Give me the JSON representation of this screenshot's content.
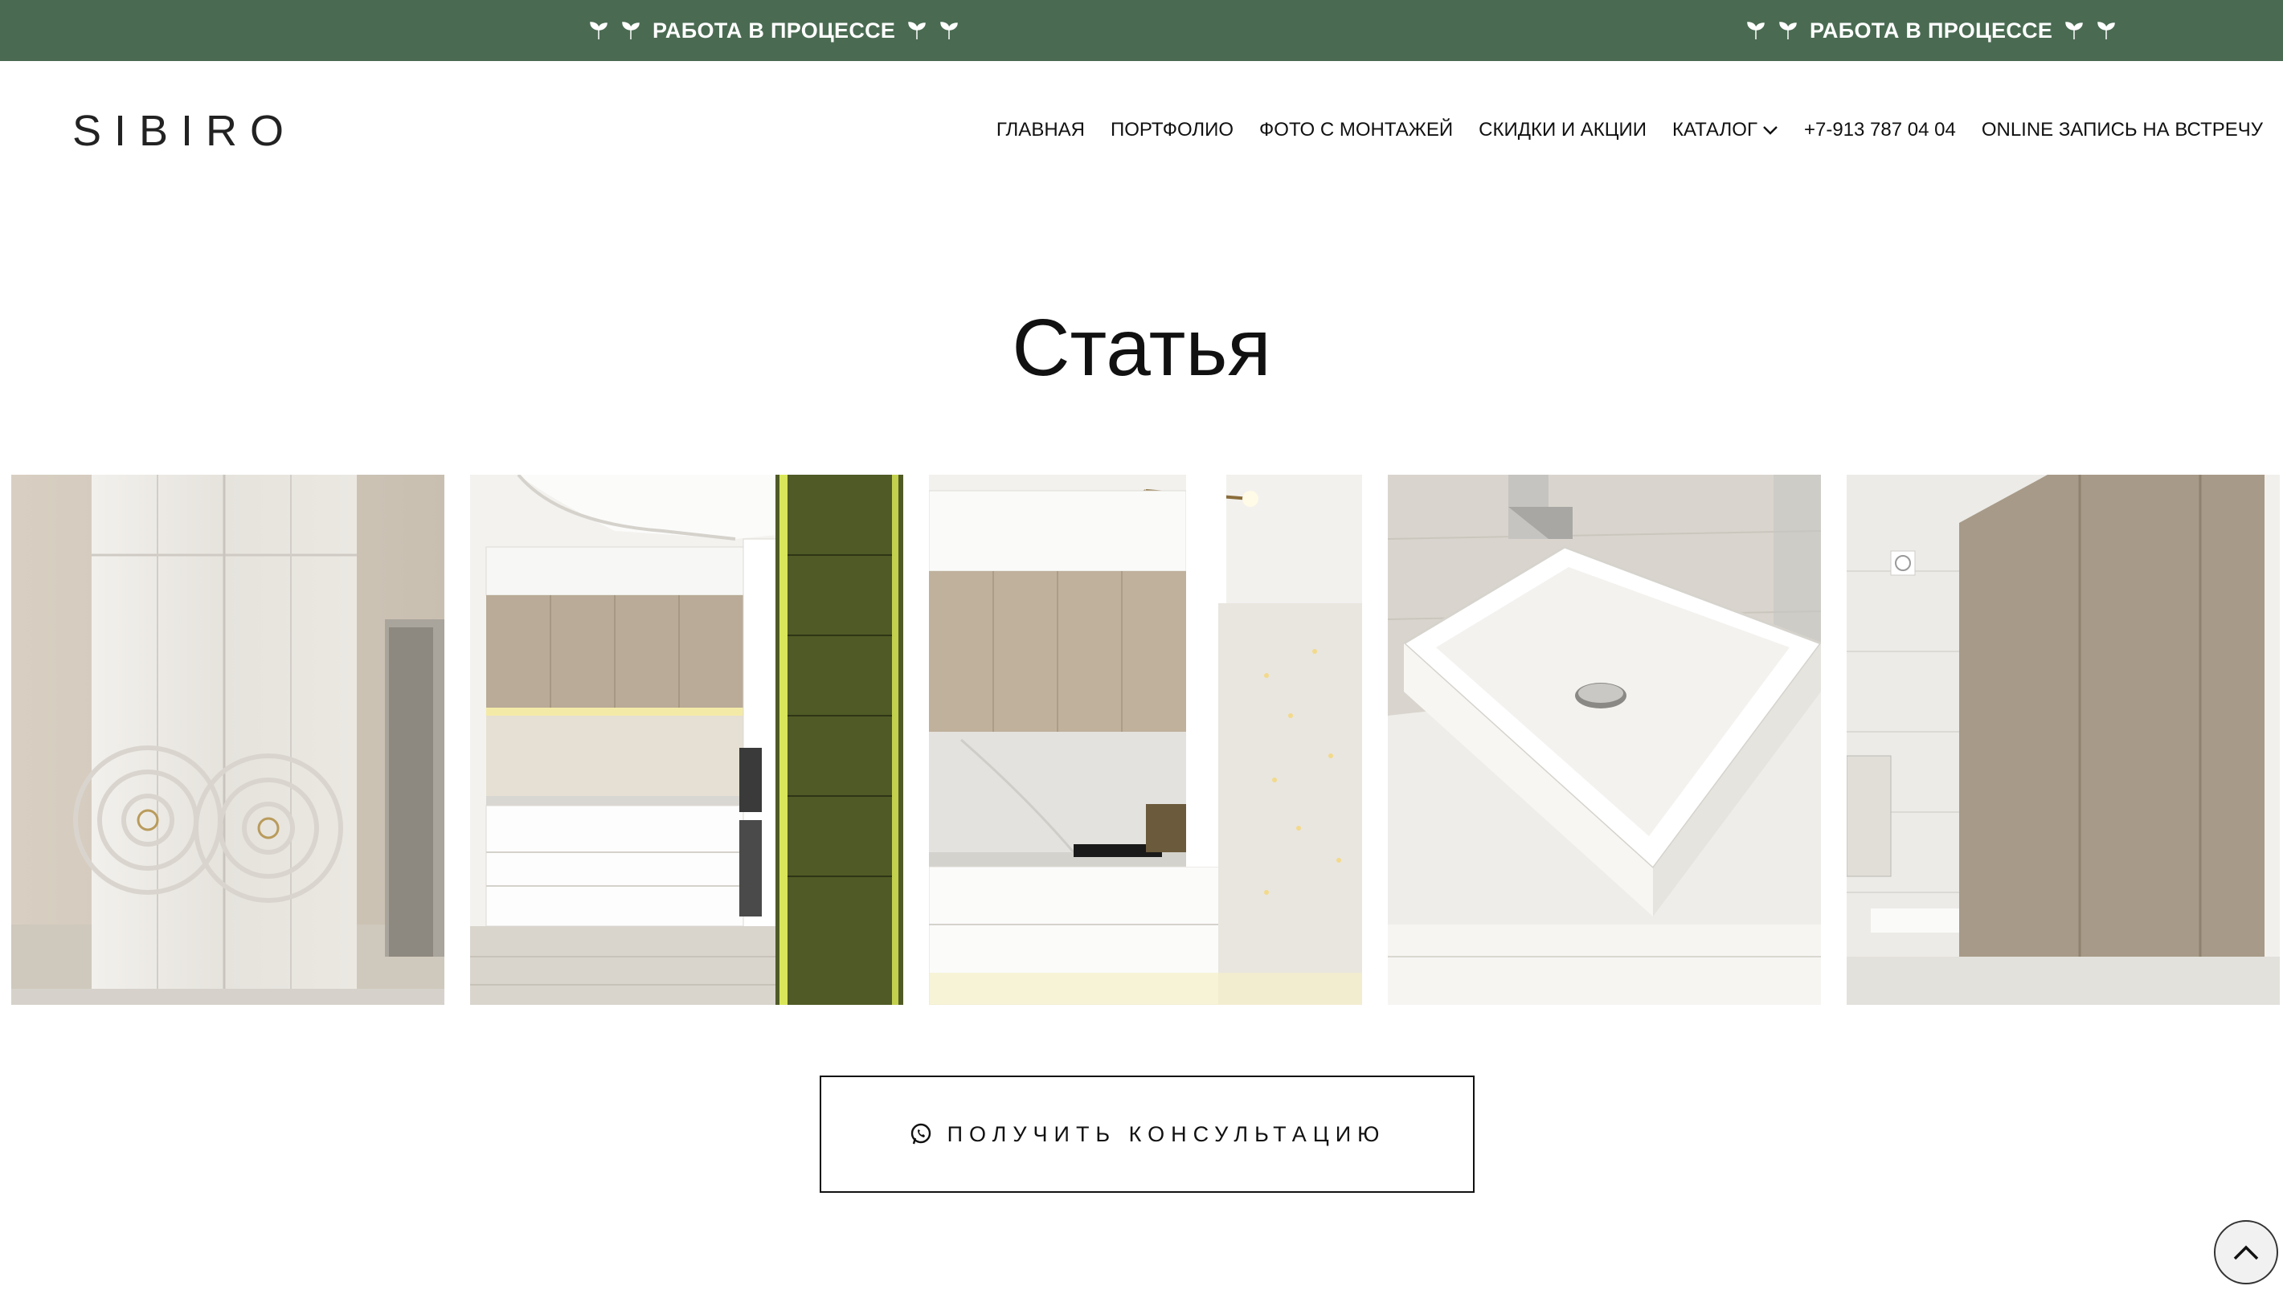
{
  "banner": {
    "text_left": "РАБОТА В ПРОЦЕССЕ",
    "text_right": "РАБОТА В ПРОЦЕССЕ",
    "background": "#4a6b52"
  },
  "header": {
    "logo": "SIBIRO",
    "nav": [
      {
        "label": "ГЛАВНАЯ"
      },
      {
        "label": "ПОРТФОЛИО"
      },
      {
        "label": "ФОТО С МОНТАЖЕЙ"
      },
      {
        "label": "СКИДКИ И АКЦИИ"
      },
      {
        "label": "КАТАЛОГ",
        "icon": "chevron-down-icon"
      },
      {
        "label": "+7-913 787 04 04"
      },
      {
        "label": "ONLINE ЗАПИСЬ НА ВСТРЕЧУ"
      }
    ]
  },
  "main": {
    "title": "Статья",
    "gallery": [
      {
        "subject": "white wardrobe with circular relief doors"
      },
      {
        "subject": "white corner kitchen with wood upper cabinets"
      },
      {
        "subject": "kitchen with marble backsplash and chandelier"
      },
      {
        "subject": "white vessel sink on vanity"
      },
      {
        "subject": "bathroom with taupe built-in cabinet"
      }
    ],
    "cta": {
      "label": "ПОЛУЧИТЬ КОНСУЛЬТАЦИЮ",
      "icon": "whatsapp-icon"
    }
  },
  "scroll_top": {
    "icon": "chevron-up-icon"
  }
}
